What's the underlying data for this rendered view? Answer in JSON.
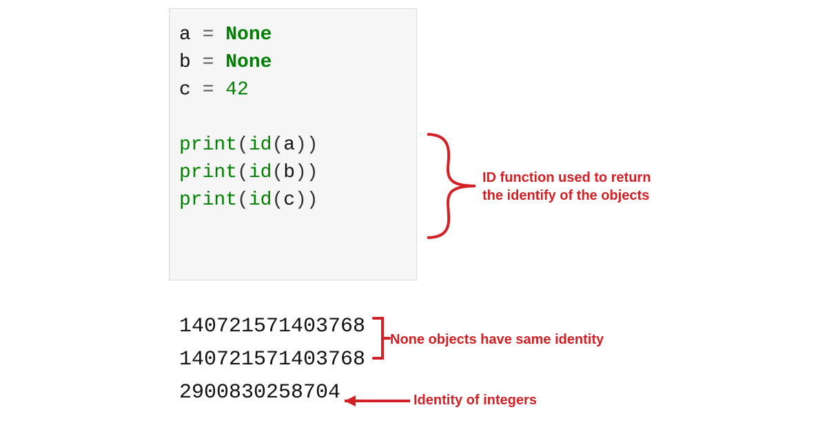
{
  "code": {
    "line1": {
      "var": "a",
      "op": "=",
      "value": "None"
    },
    "line2": {
      "var": "b",
      "op": "=",
      "value": "None"
    },
    "line3": {
      "var": "c",
      "op": "=",
      "value": "42"
    },
    "print": "print",
    "id": "id",
    "open": "(",
    "close": ")",
    "call1_arg": "a",
    "call2_arg": "b",
    "call3_arg": "c"
  },
  "output": {
    "line1": "140721571403768",
    "line2": "140721571403768",
    "line3": "2900830258704"
  },
  "annotations": {
    "id_fn_l1": "ID function used to return",
    "id_fn_l2": "the identify of the objects",
    "none_same": "None objects have same identity",
    "int_identity": "Identity of integers"
  },
  "colors": {
    "accent": "#d32024",
    "keyword": "#008000",
    "code_bg": "#f6f6f6"
  }
}
